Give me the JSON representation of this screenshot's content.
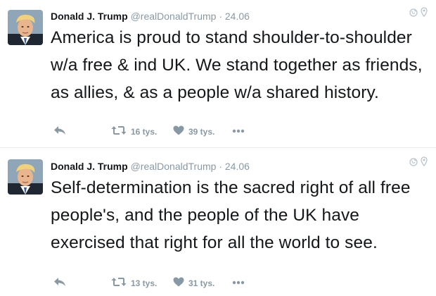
{
  "tweets": [
    {
      "author_name": "Donald J. Trump",
      "handle": "@realDonaldTrump",
      "separator": "·",
      "date": "24.06",
      "text": "America is proud to stand shoulder-to-shoulder w/a free & ind UK. We stand together as friends, as allies, & as a people w/a shared history.",
      "retweets": "16 tys.",
      "likes": "39 tys."
    },
    {
      "author_name": "Donald J. Trump",
      "handle": "@realDonaldTrump",
      "separator": "·",
      "date": "24.06",
      "text": "Self-determination is the sacred right of all free people's, and the people of the UK have exercised that right for all the world to see.",
      "retweets": "13 tys.",
      "likes": "31 tys."
    }
  ],
  "icons": {
    "reply": "reply-icon",
    "retweet": "retweet-icon",
    "like": "heart-icon",
    "more": "more-dots-icon",
    "globe": "globe-icon",
    "location": "location-pin-icon"
  },
  "colors": {
    "text": "#14171a",
    "muted": "#8899a6",
    "divider": "#e6ecf0"
  }
}
